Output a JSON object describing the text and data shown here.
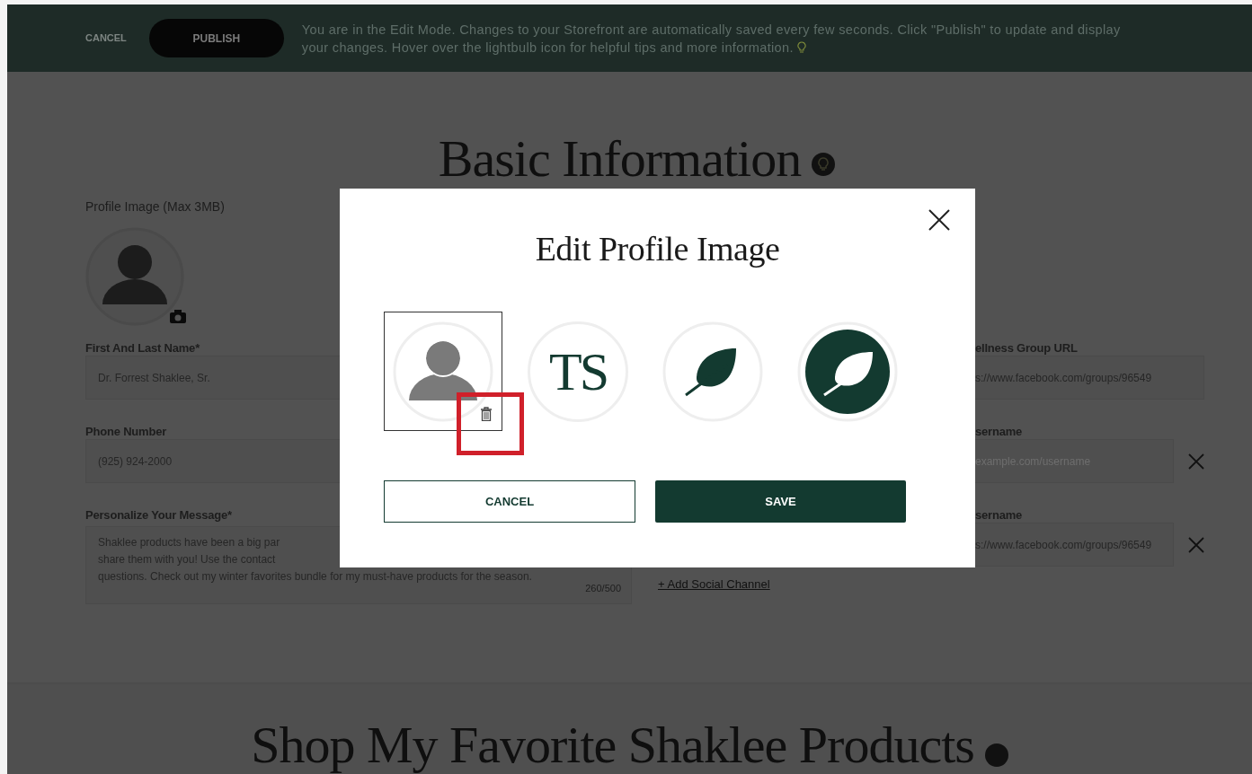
{
  "top_bar": {
    "cancel": "CANCEL",
    "publish": "PUBLISH",
    "notice": "You are in the Edit Mode. Changes to your Storefront are automatically saved every few seconds. Click \"Publish\" to update and display your changes. Hover over the lightbulb icon for helpful tips and more information."
  },
  "section": {
    "title": "Basic Information",
    "profile_image_label": "Profile Image (Max 3MB)",
    "left_fields": [
      {
        "kind": "input",
        "label": "First And Last Name*",
        "value": "Dr. Forrest Shaklee, Sr."
      },
      {
        "kind": "input",
        "label": "Phone Number",
        "value": "(925) 924-2000"
      },
      {
        "kind": "textarea",
        "label": "Personalize Your Message*",
        "lines": [
          "Shaklee products have been a big par",
          "share them with you! Use the contact",
          "questions. Check out my winter favorites bundle for my must-have products for the season."
        ],
        "counter": "260/500"
      }
    ],
    "right_fields": [
      {
        "label": "ellness Group URL",
        "value": "s://www.facebook.com/groups/96549",
        "removable": false
      },
      {
        "label": "sername",
        "placeholder": "example.com/username",
        "removable": true
      },
      {
        "label": "sername",
        "value": "s://www.facebook.com/groups/96549",
        "removable": true
      }
    ],
    "add_link": "+ Add Social Channel"
  },
  "next_section": {
    "title": "Shop My Favorite Shaklee Products"
  },
  "modal": {
    "title": "Edit Profile Image",
    "options": [
      {
        "kind": "avatar",
        "selected": true,
        "deletable": true
      },
      {
        "kind": "initials",
        "text": "TS",
        "selected": false,
        "deletable": false
      },
      {
        "kind": "leaf",
        "selected": false,
        "deletable": false
      },
      {
        "kind": "leaf-filled",
        "selected": false,
        "deletable": false
      }
    ],
    "cancel": "CANCEL",
    "save": "SAVE"
  }
}
